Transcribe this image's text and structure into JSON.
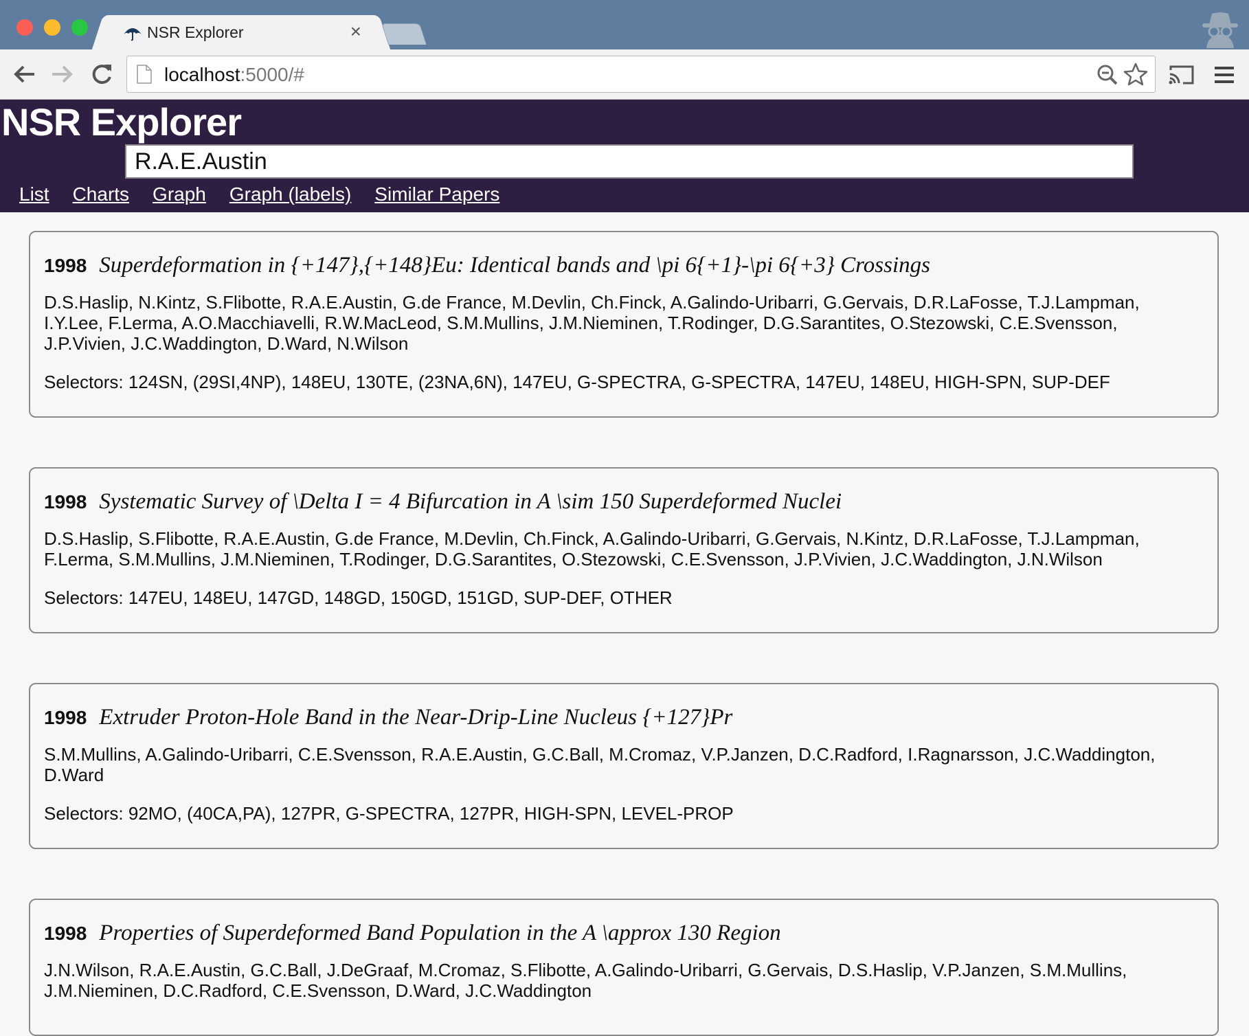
{
  "browser": {
    "tab_title": "NSR Explorer",
    "tab_close": "×",
    "url_host": "localhost",
    "url_rest": ":5000/#"
  },
  "app": {
    "title": "NSR Explorer",
    "search_value": "R.A.E.Austin",
    "nav": [
      "List",
      "Charts",
      "Graph",
      "Graph (labels)",
      "Similar Papers"
    ]
  },
  "papers": [
    {
      "year": "1998",
      "title": "Superdeformation in {+147},{+148}Eu: Identical bands and \\pi 6{+1}-\\pi 6{+3} Crossings",
      "authors": "D.S.Haslip, N.Kintz, S.Flibotte, R.A.E.Austin, G.de France, M.Devlin, Ch.Finck, A.Galindo-Uribarri, G.Gervais, D.R.LaFosse, T.J.Lampman, I.Y.Lee, F.Lerma, A.O.Macchiavelli, R.W.MacLeod, S.M.Mullins, J.M.Nieminen, T.Rodinger, D.G.Sarantites, O.Stezowski, C.E.Svensson, J.P.Vivien, J.C.Waddington, D.Ward, N.Wilson",
      "selectors": "Selectors: 124SN, (29SI,4NP), 148EU, 130TE, (23NA,6N), 147EU, G-SPECTRA, G-SPECTRA, 147EU, 148EU, HIGH-SPN, SUP-DEF"
    },
    {
      "year": "1998",
      "title": "Systematic Survey of \\Delta I = 4 Bifurcation in A \\sim 150 Superdeformed Nuclei",
      "authors": "D.S.Haslip, S.Flibotte, R.A.E.Austin, G.de France, M.Devlin, Ch.Finck, A.Galindo-Uribarri, G.Gervais, N.Kintz, D.R.LaFosse, T.J.Lampman, F.Lerma, S.M.Mullins, J.M.Nieminen, T.Rodinger, D.G.Sarantites, O.Stezowski, C.E.Svensson, J.P.Vivien, J.C.Waddington, J.N.Wilson",
      "selectors": "Selectors: 147EU, 148EU, 147GD, 148GD, 150GD, 151GD, SUP-DEF, OTHER"
    },
    {
      "year": "1998",
      "title": "Extruder Proton-Hole Band in the Near-Drip-Line Nucleus {+127}Pr",
      "authors": "S.M.Mullins, A.Galindo-Uribarri, C.E.Svensson, R.A.E.Austin, G.C.Ball, M.Cromaz, V.P.Janzen, D.C.Radford, I.Ragnarsson, J.C.Waddington, D.Ward",
      "selectors": "Selectors: 92MO, (40CA,PA), 127PR, G-SPECTRA, 127PR, HIGH-SPN, LEVEL-PROP"
    },
    {
      "year": "1998",
      "title": "Properties of Superdeformed Band Population in the A \\approx 130 Region",
      "authors": "J.N.Wilson, R.A.E.Austin, G.C.Ball, J.DeGraaf, M.Cromaz, S.Flibotte, A.Galindo-Uribarri, G.Gervais, D.S.Haslip, V.P.Janzen, S.M.Mullins, J.M.Nieminen, D.C.Radford, C.E.Svensson, D.Ward, J.C.Waddington",
      "selectors": ""
    }
  ]
}
